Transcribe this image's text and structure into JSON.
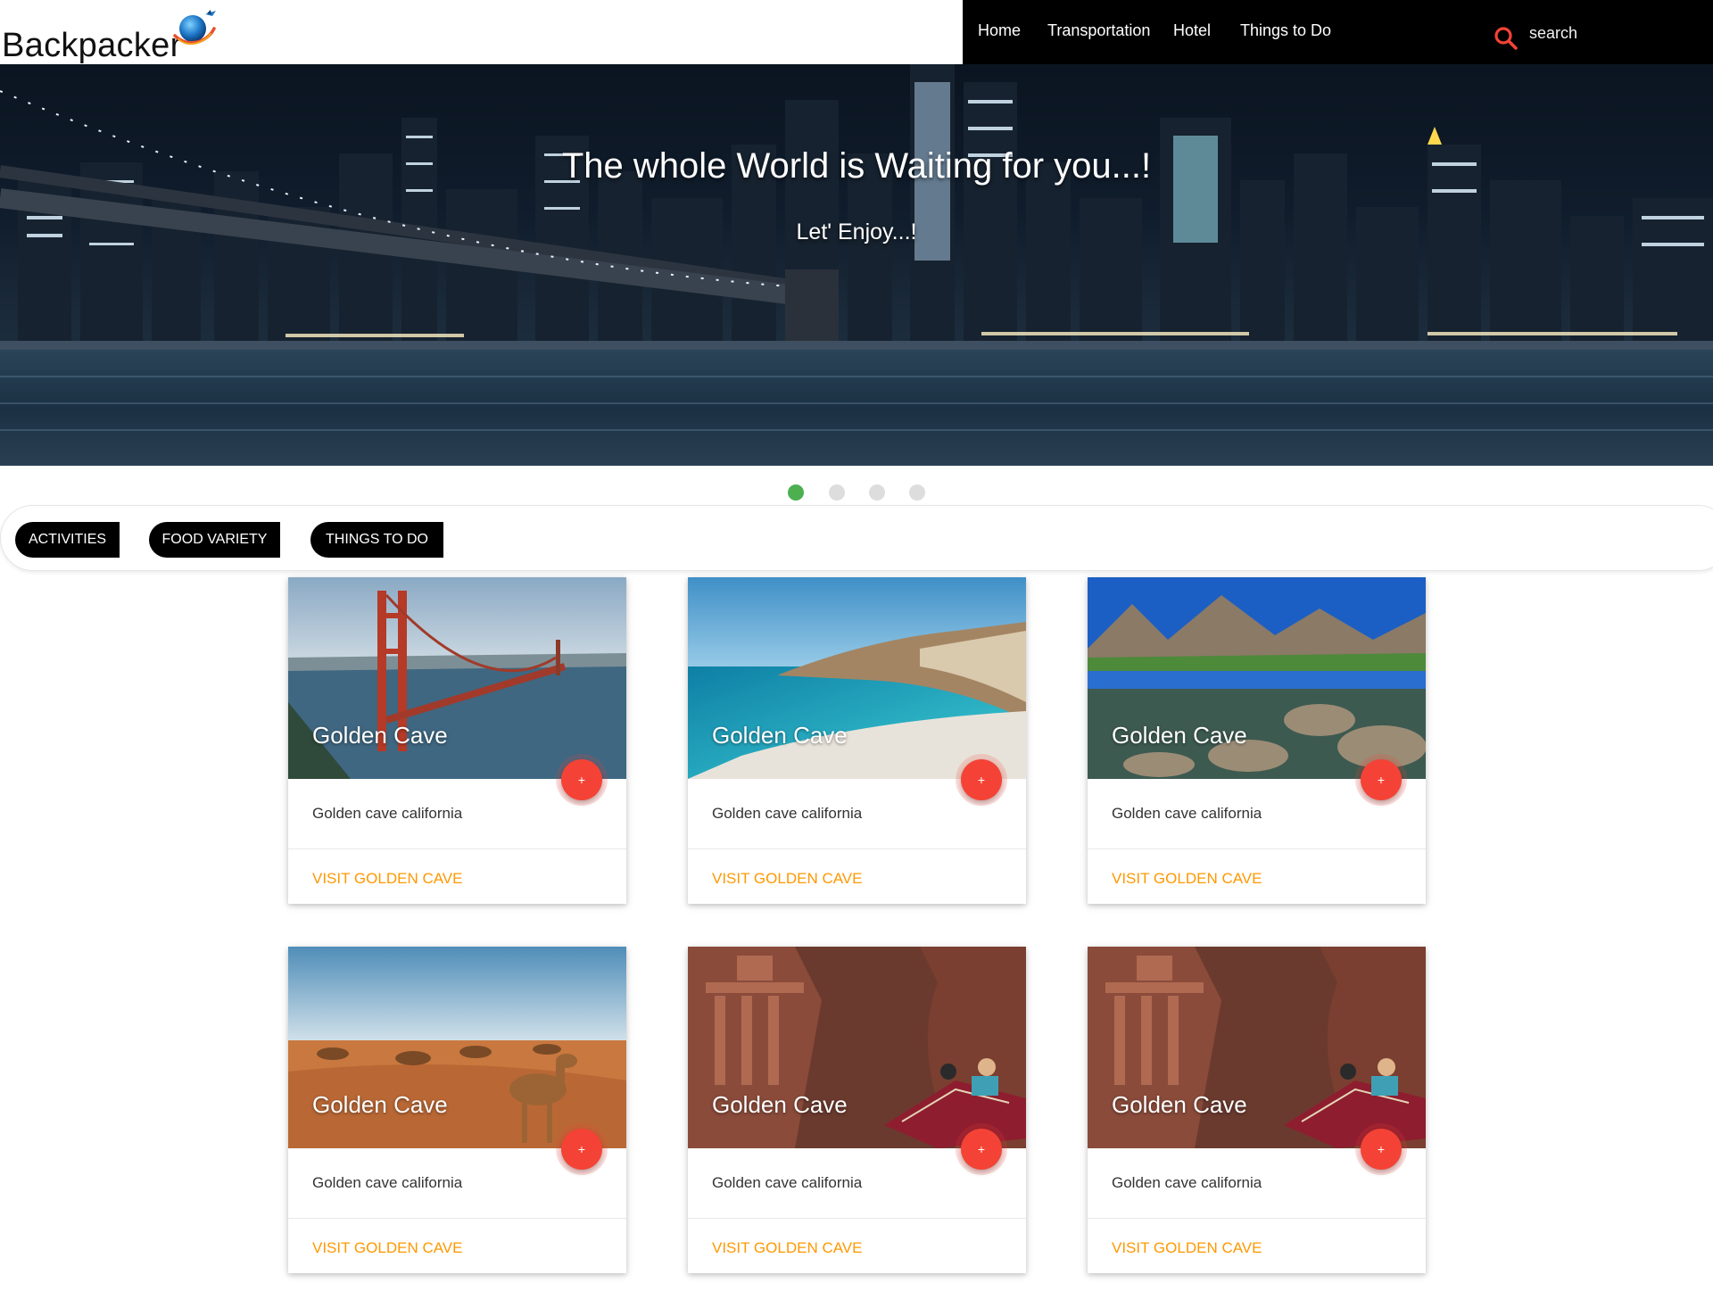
{
  "header": {
    "brand_name": "Backpacker",
    "nav": [
      "Home",
      "Transportation",
      "Hotel",
      "Things to Do"
    ],
    "search_placeholder": "search",
    "icons": {
      "logo": "globe-plane-logo",
      "search": "search-icon"
    },
    "search_icon_color": "#f44336"
  },
  "hero": {
    "title": "The whole World is Waiting for you...!",
    "subtitle": "Let' Enjoy...!",
    "slide_count": 4,
    "active_slide": 1,
    "active_dot_color": "#4caf50"
  },
  "tabs": [
    "ACTIVITIES",
    "FOOD VARIETY",
    "THINGS TO DO"
  ],
  "cards": [
    {
      "title": "Golden Cave",
      "description": "Golden cave california",
      "link": "VISIT GOLDEN CAVE",
      "fab": "+",
      "image": "golden-gate-bridge"
    },
    {
      "title": "Golden Cave",
      "description": "Golden cave california",
      "link": "VISIT GOLDEN CAVE",
      "fab": "+",
      "image": "turquoise-beach"
    },
    {
      "title": "Golden Cave",
      "description": "Golden cave california",
      "link": "VISIT GOLDEN CAVE",
      "fab": "+",
      "image": "mountain-lake"
    },
    {
      "title": "Golden Cave",
      "description": "Golden cave california",
      "link": "VISIT GOLDEN CAVE",
      "fab": "+",
      "image": "desert-camels"
    },
    {
      "title": "Golden Cave",
      "description": "Golden cave california",
      "link": "VISIT GOLDEN CAVE",
      "fab": "+",
      "image": "petra-treasury"
    },
    {
      "title": "Golden Cave",
      "description": "Golden cave california",
      "link": "VISIT GOLDEN CAVE",
      "fab": "+",
      "image": "petra-treasury"
    }
  ],
  "colors": {
    "fab": "#f44336",
    "link": "#ff9800",
    "navbar": "#000000"
  }
}
